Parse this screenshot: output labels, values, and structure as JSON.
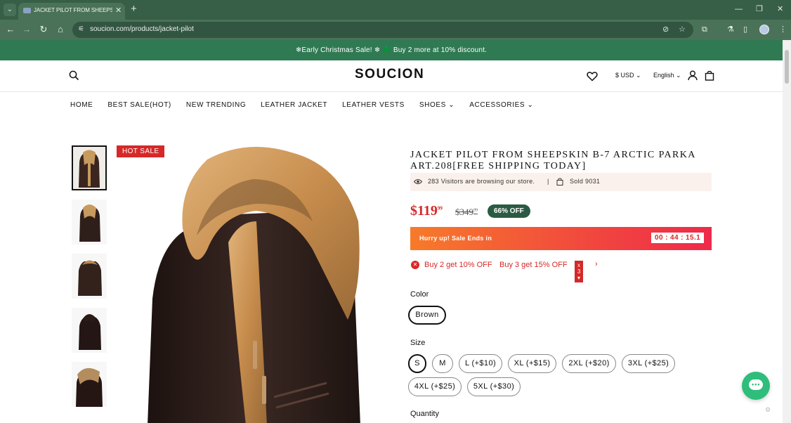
{
  "browser": {
    "tab_title": "JACKET PILOT FROM SHEEPSKIN",
    "url": "soucion.com/products/jacket-pilot",
    "icons": {
      "tab_menu": "chevron-down-icon",
      "tab_close": "close-icon",
      "new_tab": "plus-icon",
      "back": "arrow-left-icon",
      "forward": "arrow-right-icon",
      "reload": "reload-icon",
      "home": "home-icon",
      "site_info": "tune-icon",
      "eye_off": "eye-off-icon",
      "bookmark": "star-icon",
      "extensions": "puzzle-icon",
      "labs": "flask-icon",
      "side_panel": "sidebar-icon",
      "menu": "kebab-icon"
    }
  },
  "announcement": "❄Early Christmas Sale! ❄ 🌲 Buy 2 more at 10% discount.",
  "header": {
    "logo": "SOUCION",
    "currency": "$ USD",
    "language": "English"
  },
  "nav": [
    "HOME",
    "BEST SALE(HOT)",
    "NEW TRENDING",
    "LEATHER JACKET",
    "LEATHER VESTS",
    "SHOES",
    "ACCESSORIES"
  ],
  "gallery": {
    "badge": "HOT SALE",
    "thumbnail_count": 5
  },
  "product": {
    "title": "JACKET PILOT FROM SHEEPSKIN B-7 ARCTIC PARKA ART.208[FREE SHIPPING TODAY]",
    "visitors_text": "283 Visitors are browsing our store.",
    "separator": "|",
    "sold_text": "Sold 9031",
    "price": "$119",
    "price_cents": "99",
    "old_price": "$349",
    "old_price_cents": "99",
    "discount_badge": "66% OFF",
    "sale_label": "Hurry up! Sale Ends in",
    "countdown": "00 : 44 : 15.1",
    "promo_1": "Buy 2 get 10% OFF",
    "promo_2": "Buy 3 get 15% OFF",
    "promo_qty": "x 3",
    "color_label": "Color",
    "color_options": [
      "Brown"
    ],
    "size_label": "Size",
    "size_options": [
      "S",
      "M",
      "L (+$10)",
      "XL (+$15)",
      "2XL (+$20)",
      "3XL (+$25)",
      "4XL (+$25)",
      "5XL (+$30)"
    ],
    "quantity_label": "Quantity"
  },
  "colors": {
    "brand_green": "#2f7a53",
    "sale_red": "#d62828",
    "badge_green": "#2b5a42",
    "chat_green": "#2fbd7b"
  }
}
